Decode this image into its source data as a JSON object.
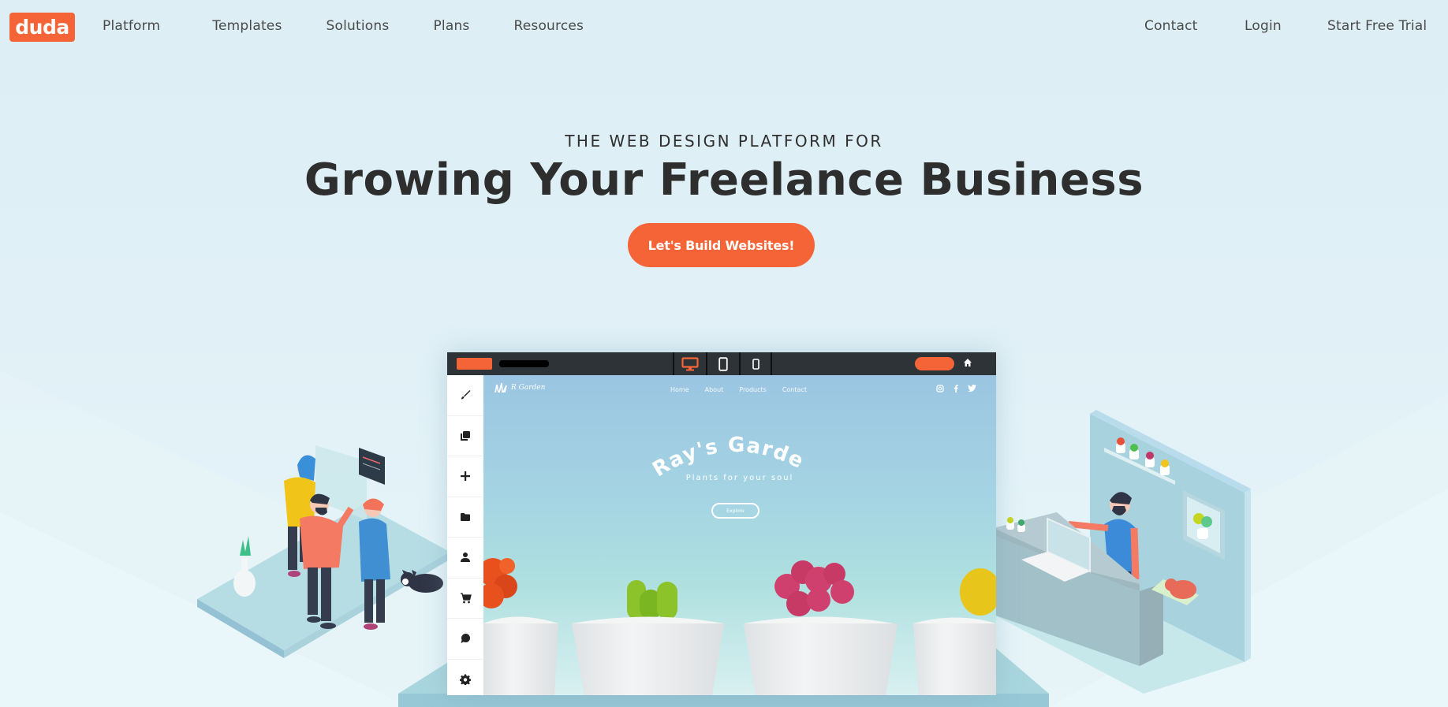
{
  "brand": {
    "logo_text": "duda",
    "accent_color": "#f56437",
    "text_dark": "#2e2e2e"
  },
  "nav": {
    "left_items": [
      {
        "label": "Platform"
      },
      {
        "label": "Templates"
      },
      {
        "label": "Solutions"
      },
      {
        "label": "Plans"
      },
      {
        "label": "Resources"
      }
    ],
    "right_items": [
      {
        "label": "Contact"
      },
      {
        "label": "Login"
      },
      {
        "label": "Start Free Trial"
      }
    ]
  },
  "hero": {
    "eyebrow": "THE WEB DESIGN PLATFORM FOR",
    "headline": "Growing Your Freelance Business",
    "cta_label": "Let's Build Websites!"
  },
  "editor_mock": {
    "device_icons": [
      "desktop-icon",
      "tablet-icon",
      "mobile-icon"
    ],
    "active_device": "desktop-icon",
    "sidebar_icons": [
      "brush-icon",
      "pages-icon",
      "add-icon",
      "folder-icon",
      "person-icon",
      "cart-icon",
      "chat-icon",
      "gear-icon"
    ],
    "site": {
      "logo_text": "R Garden",
      "nav_items": [
        "Home",
        "About",
        "Products",
        "Contact"
      ],
      "social_icons": [
        "instagram-icon",
        "facebook-icon",
        "twitter-icon"
      ],
      "title": "Ray's Garden",
      "subtitle": "Plants for your soul",
      "button_label": "Explore",
      "cactus_colors": [
        "#e8501e",
        "#8cc22a",
        "#d0406e",
        "#e8c51a"
      ]
    }
  },
  "illustrations": {
    "left": "team-collaborating-illustration",
    "right": "shop-owner-illustration"
  }
}
